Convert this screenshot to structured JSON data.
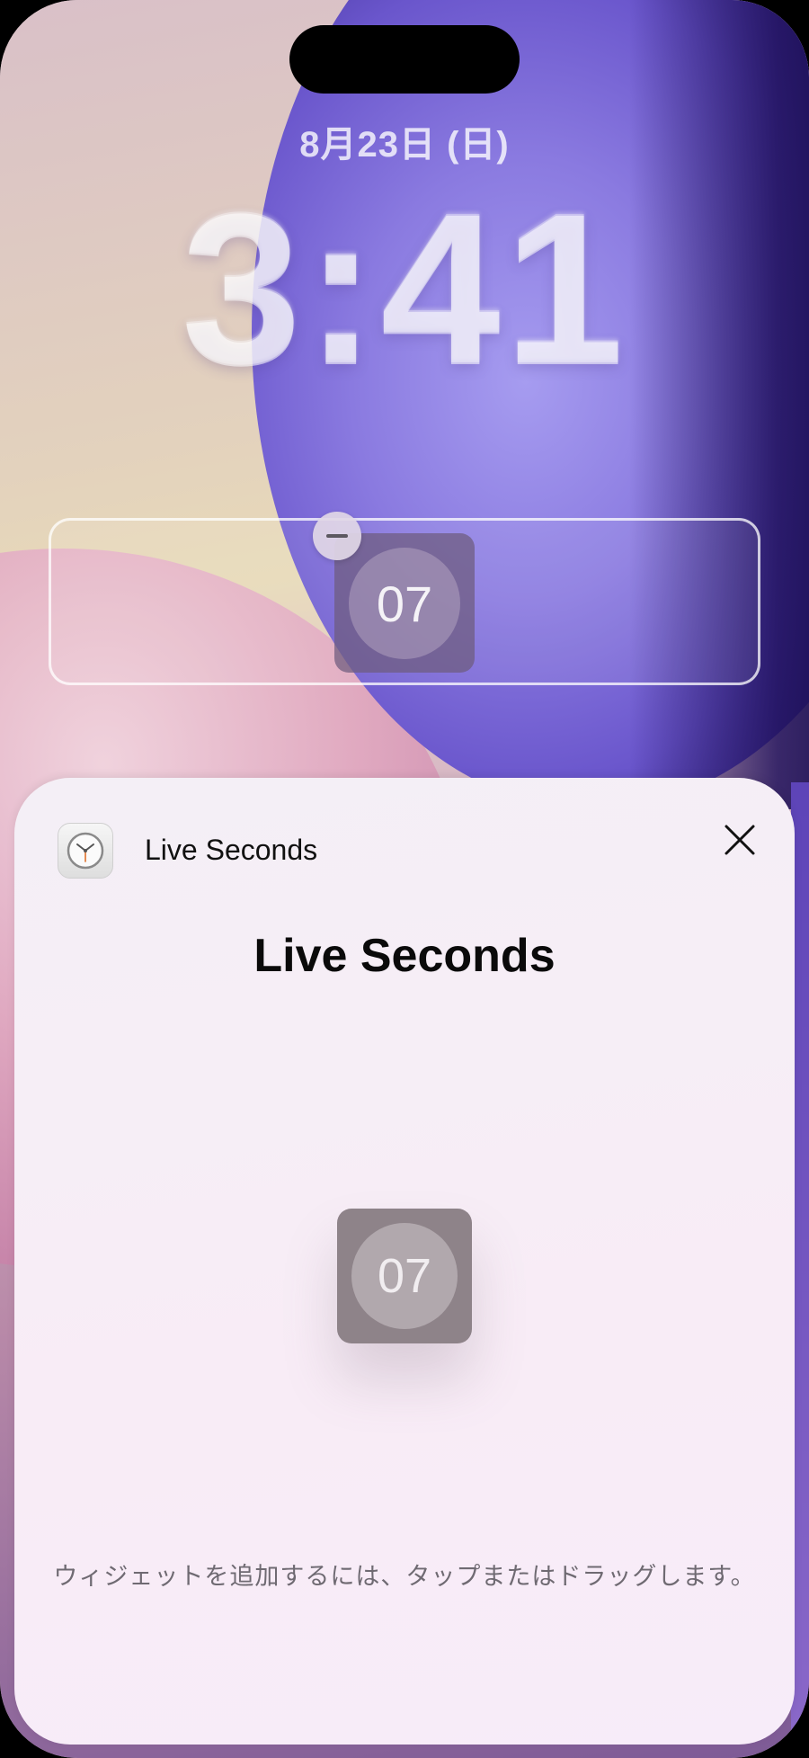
{
  "lockscreen": {
    "date": "8月23日 (日)",
    "time": "3:41",
    "widget_value": "07"
  },
  "sheet": {
    "app_name": "Live Seconds",
    "title": "Live Seconds",
    "preview_value": "07",
    "hint": "ウィジェットを追加するには、タップまたはドラッグします。"
  },
  "icons": {
    "remove": "minus-icon",
    "close": "close-icon",
    "app": "clock-icon"
  }
}
